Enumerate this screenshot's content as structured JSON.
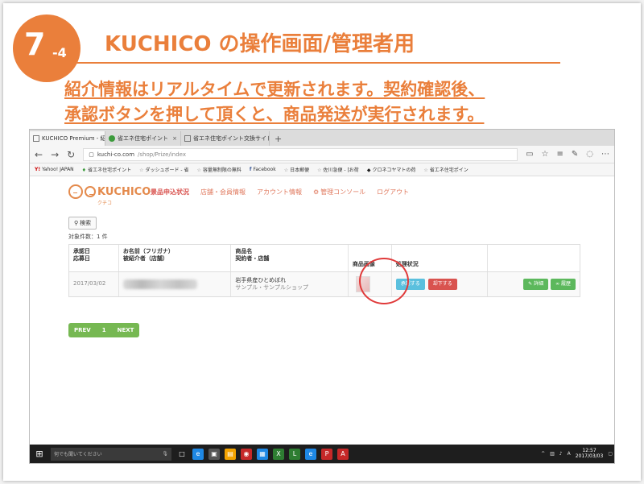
{
  "slide": {
    "badge_number": "7",
    "badge_sub": "-4",
    "title": "KUCHICO の操作画面/管理者用",
    "subtitle_line1": "紹介情報はリアルタイムで更新されます。契約確認後、",
    "subtitle_line2": "承認ボタンを押して頂くと、商品発送が実行されます。"
  },
  "browser": {
    "tabs": [
      {
        "label": "KUCHICO Premium - 紹",
        "close": "×"
      },
      {
        "label": "省エネ住宅ポイント",
        "close": "×"
      },
      {
        "label": "省エネ住宅ポイント交換サイト",
        "close": "×"
      }
    ],
    "new_tab": "+",
    "url_host": "kuchi-co.com",
    "url_path": "/shop/Prize/index",
    "bookmarks": [
      {
        "icon": "Y!",
        "label": "Yahoo! JAPAN"
      },
      {
        "icon": "♦",
        "label": "省エネ住宅ポイント"
      },
      {
        "icon": "☆",
        "label": "ダッシュボード - 省"
      },
      {
        "icon": "☆",
        "label": "容量無制限の無料"
      },
      {
        "icon": "f",
        "label": "Facebook"
      },
      {
        "icon": "☆",
        "label": "日本郵便"
      },
      {
        "icon": "☆",
        "label": "佐川急便 - [お荷"
      },
      {
        "icon": "◆",
        "label": "クロネコヤマトの荷"
      },
      {
        "icon": "☆",
        "label": "省エネ住宅ポイン"
      }
    ]
  },
  "site": {
    "logo_text": "KUCHICO",
    "logo_kana": "クチコ",
    "nav": [
      "景品申込状況",
      "店舗・会員情報",
      "アカウント情報",
      "管理コンソール",
      "ログアウト"
    ],
    "search_label": "検索",
    "result_count": "対象件数：1 件",
    "table": {
      "headers": [
        [
          "承認日",
          "応募日"
        ],
        [
          "お名前（フリガナ）",
          "被紹介者（店舗）"
        ],
        [
          "商品名",
          "契約者・店舗"
        ],
        [
          "商品画像"
        ],
        [
          "処理状況"
        ],
        [
          ""
        ]
      ],
      "row": {
        "date": "2017/03/02",
        "product": "岩手県産ひとめぼれ",
        "shop": "サンプル・サンプルショップ",
        "approve_label": "承認する",
        "reject_label": "却下する",
        "detail_label": "詳細",
        "link_label": "履歴"
      }
    },
    "pager": {
      "prev": "PREV",
      "page": "1",
      "next": "NEXT"
    }
  },
  "taskbar": {
    "search_placeholder": "何でも聞いてください",
    "time": "12:57",
    "date": "2017/03/03"
  }
}
